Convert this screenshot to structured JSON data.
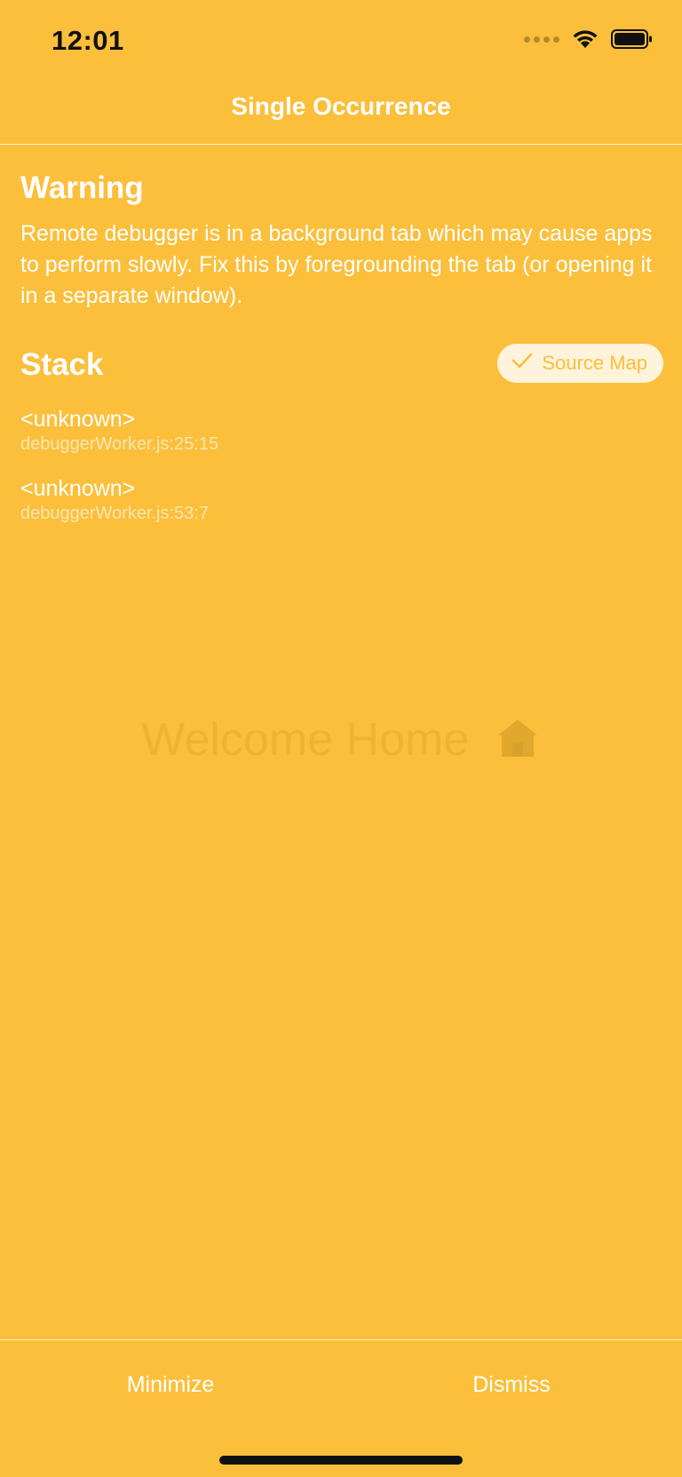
{
  "status_bar": {
    "time": "12:01"
  },
  "header": {
    "title": "Single Occurrence"
  },
  "warning": {
    "heading": "Warning",
    "message": "Remote debugger is in a background tab which may cause apps to perform slowly. Fix this by foregrounding the tab (or opening it in a separate window)."
  },
  "stack": {
    "heading": "Stack",
    "source_map_label": "Source Map",
    "frames": [
      {
        "method": "<unknown>",
        "file": "debuggerWorker.js:25:15"
      },
      {
        "method": "<unknown>",
        "file": "debuggerWorker.js:53:7"
      }
    ]
  },
  "background": {
    "text": "Welcome Home"
  },
  "footer": {
    "minimize_label": "Minimize",
    "dismiss_label": "Dismiss"
  },
  "colors": {
    "background": "#FBBF3B",
    "text": "#FFFFFF"
  },
  "icons": [
    "wifi-icon",
    "battery-icon",
    "signal-icon",
    "checkmark-icon",
    "house-icon"
  ]
}
